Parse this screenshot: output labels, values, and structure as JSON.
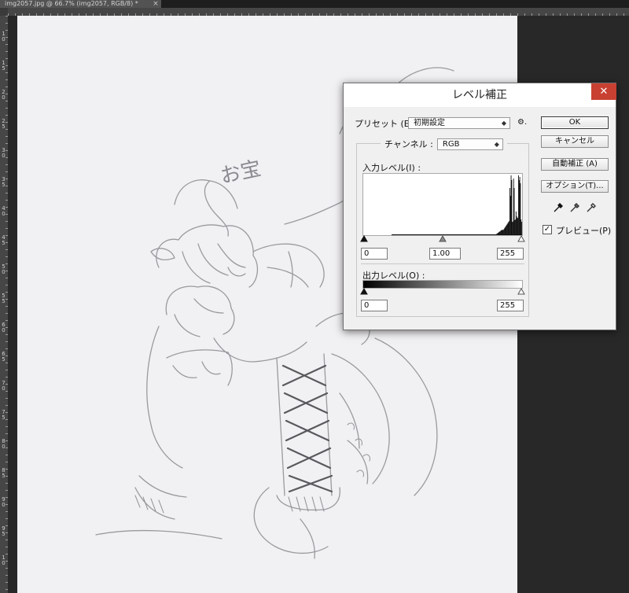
{
  "document_tab": {
    "title": "img2057.jpg @ 66.7% (img2057, RGB/8) *",
    "close": "×"
  },
  "rulers": {
    "left_labels": [
      "1\n0",
      "1\n5",
      "2\n0",
      "2\n5",
      "3\n0",
      "3\n5",
      "4\n0",
      "4\n5",
      "5\n0",
      "5\n5",
      "6\n0",
      "6\n5",
      "7\n0",
      "7\n5",
      "8\n0",
      "8\n5",
      "9\n0",
      "9\n5",
      "1\n0"
    ]
  },
  "sketch": {
    "handwriting": "お宝"
  },
  "levels_dialog": {
    "title": "レベル補正",
    "close": "✕",
    "preset": {
      "label": "プリセット (E) :",
      "value": "初期設定",
      "gear": "⚙."
    },
    "channel": {
      "label": "チャンネル :",
      "value": "RGB"
    },
    "input_levels": {
      "label": "入力レベル(I) :",
      "black": "0",
      "gamma": "1.00",
      "white": "255"
    },
    "output_levels": {
      "label": "出力レベル(O) :",
      "black": "0",
      "white": "255"
    },
    "buttons": {
      "ok": "OK",
      "cancel": "キャンセル",
      "auto": "自動補正 (A)",
      "options": "オプション(T)..."
    },
    "preview": {
      "label": "プレビュー(P)",
      "checked": true,
      "check_glyph": "✓"
    },
    "histogram": {
      "peak_levels": [
        236,
        238,
        242,
        246,
        250,
        252,
        254
      ]
    }
  },
  "colors": {
    "close_red": "#c84031",
    "workspace": "#282828",
    "paper": "#f1f0f3"
  }
}
